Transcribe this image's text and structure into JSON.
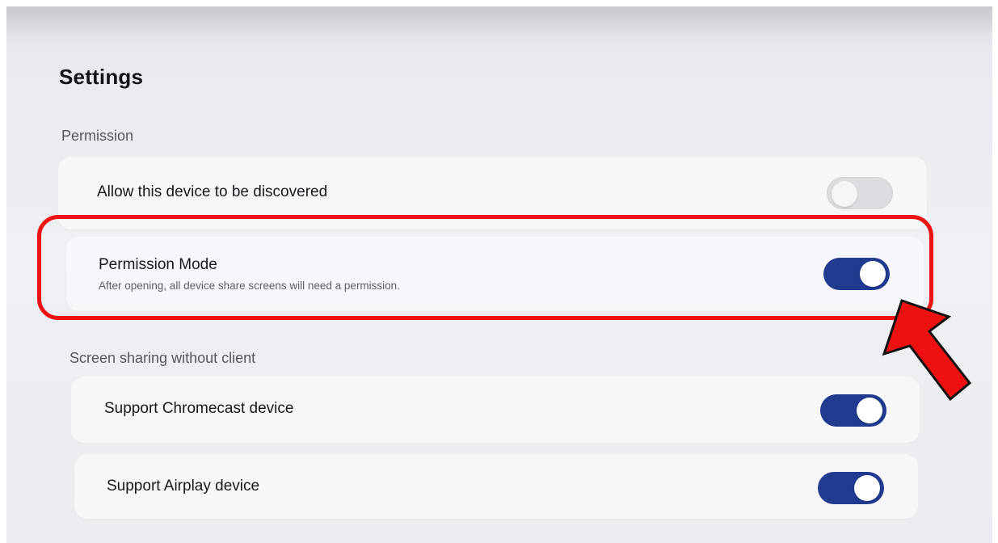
{
  "page": {
    "title": "Settings"
  },
  "sections": [
    {
      "label": "Permission",
      "items": [
        {
          "title": "Allow this device to be discovered",
          "subtitle": "",
          "toggle": "off"
        },
        {
          "title": "Permission Mode",
          "subtitle": "After opening, all device share screens will need a permission.",
          "toggle": "on"
        }
      ]
    },
    {
      "label": "Screen sharing without client",
      "items": [
        {
          "title": "Support Chromecast device",
          "subtitle": "",
          "toggle": "on"
        },
        {
          "title": "Support Airplay device",
          "subtitle": "",
          "toggle": "on"
        }
      ]
    }
  ],
  "colors": {
    "toggle_on": "#1f3a8f",
    "toggle_off": "#dcdde1",
    "annotation": "#ee1111"
  },
  "icons": {
    "annotation_arrow": "arrow-up-left-icon"
  }
}
